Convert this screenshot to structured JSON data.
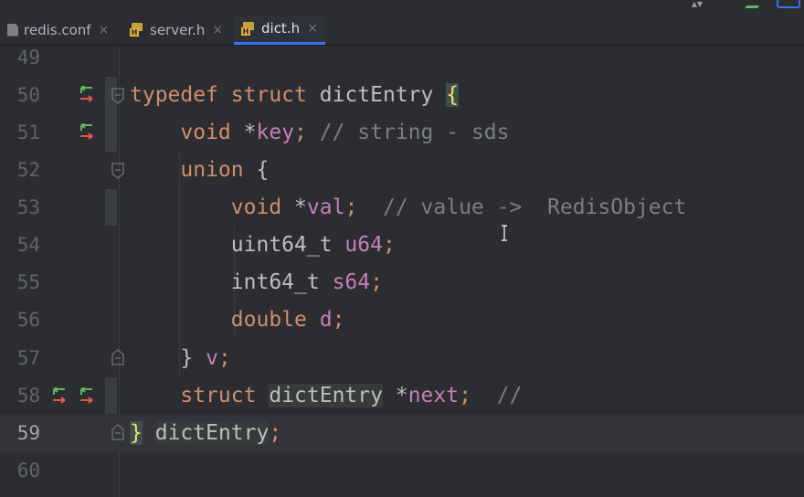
{
  "tabs": [
    {
      "label": "redis.conf",
      "icon": "config-file-icon",
      "active": false
    },
    {
      "label": "server.h",
      "icon": "header-file-icon",
      "active": false
    },
    {
      "label": "dict.h",
      "icon": "header-file-icon",
      "active": true
    }
  ],
  "header_badge": "H",
  "close_glyph": "×",
  "editor": {
    "current_line": 59,
    "lines": [
      {
        "num": "49"
      },
      {
        "num": "50",
        "t": {
          "a": "typedef",
          "b": "struct",
          "c": "dictEntry",
          "d": "{"
        }
      },
      {
        "num": "51",
        "t": {
          "a": "void",
          "b": "*",
          "c": "key",
          "d": ";",
          "e": "// string - sds"
        }
      },
      {
        "num": "52",
        "t": {
          "a": "union",
          "b": "{"
        }
      },
      {
        "num": "53",
        "t": {
          "a": "void",
          "b": "*",
          "c": "val",
          "d": ";",
          "e": "// value ->  RedisObject"
        }
      },
      {
        "num": "54",
        "t": {
          "a": "uint64_t",
          "b": "u64",
          "c": ";"
        }
      },
      {
        "num": "55",
        "t": {
          "a": "int64_t",
          "b": "s64",
          "c": ";"
        }
      },
      {
        "num": "56",
        "t": {
          "a": "double",
          "b": "d",
          "c": ";"
        }
      },
      {
        "num": "57",
        "t": {
          "a": "}",
          "b": "v",
          "c": ";"
        }
      },
      {
        "num": "58",
        "t": {
          "a": "struct",
          "b": "dictEntry",
          "c": "*",
          "d": "next",
          "e": ";",
          "f": "//"
        }
      },
      {
        "num": "59",
        "t": {
          "a": "}",
          "b": "dictEntry",
          "c": ";"
        }
      },
      {
        "num": "60"
      }
    ]
  },
  "colors": {
    "keyword": "#cf8e6d",
    "field": "#c77dbb",
    "comment": "#7a7e85",
    "brace_highlight": "#fede5d",
    "tab_active_underline": "#3574f0",
    "impl_arrow_green": "#5fb865",
    "impl_arrow_red": "#e55757"
  }
}
